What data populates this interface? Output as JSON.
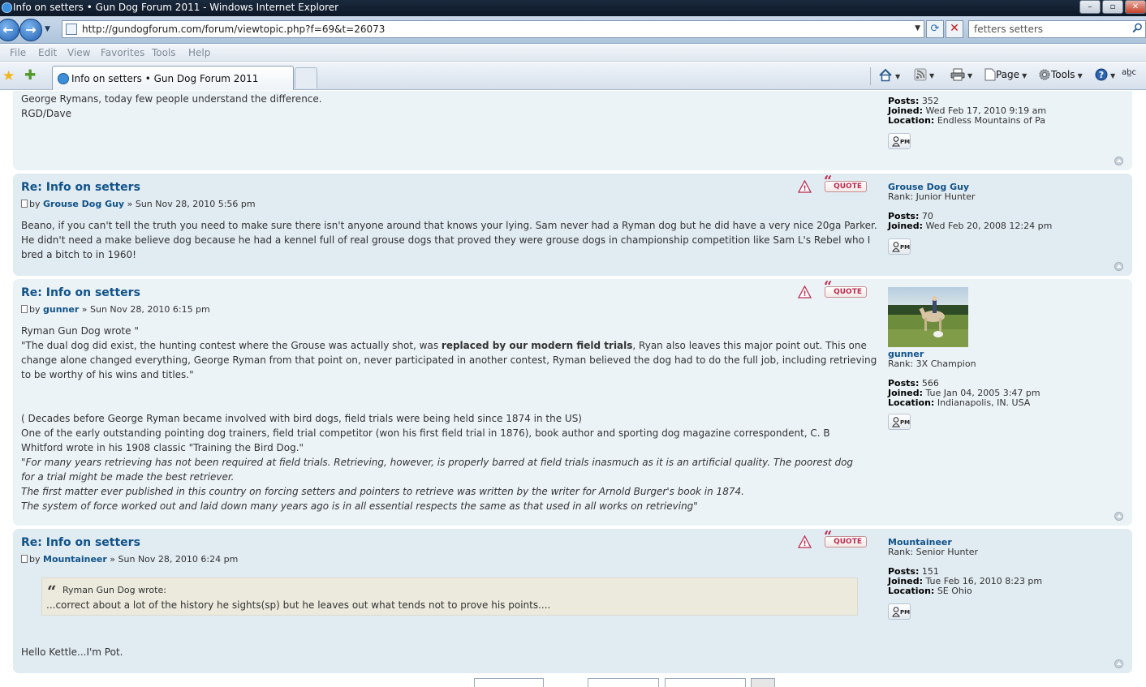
{
  "window": {
    "title": "Info on setters • Gun Dog Forum 2011 - Windows Internet Explorer",
    "min": "–",
    "max": "▫",
    "close": "✕"
  },
  "nav": {
    "back": "←",
    "forward": "→",
    "url": "http://gundogforum.com/forum/viewtopic.php?f=69&t=26073",
    "search_value": "fetters setters"
  },
  "menu": [
    "File",
    "Edit",
    "View",
    "Favorites",
    "Tools",
    "Help"
  ],
  "tab": {
    "label": "Info on setters • Gun Dog Forum 2011"
  },
  "commands": {
    "page": "Page",
    "tools": "Tools"
  },
  "colors": {
    "post_bg_1": "#ecf3f7",
    "post_bg_2": "#e1ebf2",
    "link": "#105289",
    "quote_red": "#bc2a4d"
  },
  "posts": [
    {
      "lines": [
        "George Rymans, today few people understand the difference.",
        "RGD/Dave"
      ],
      "profile": {
        "posts_label": "Posts:",
        "posts": "352",
        "joined_label": "Joined:",
        "joined": "Wed Feb 17, 2010 9:19 am",
        "location_label": "Location:",
        "location": "Endless Mountains of Pa"
      }
    },
    {
      "title": "Re: Info on setters",
      "by": "by",
      "author": "Grouse Dog Guy",
      "date": "» Sun Nov 28, 2010 5:56 pm",
      "lines": [
        "Beano, if you can't tell the truth you need to make sure there isn't anyone around that knows your lying. Sam never had a Ryman dog but he did have a very nice 20ga Parker.",
        "He didn't need a make believe dog because he had a kennel full of real grouse dogs that proved they were grouse dogs in championship competition like Sam L's Rebel who I",
        "bred a bitch to in 1960!"
      ],
      "profile": {
        "name": "Grouse Dog Guy",
        "rank": "Rank: Junior Hunter",
        "posts_label": "Posts:",
        "posts": "70",
        "joined_label": "Joined:",
        "joined": "Wed Feb 20, 2008 12:24 pm"
      },
      "quote": "QUOTE"
    },
    {
      "title": "Re: Info on setters",
      "by": "by",
      "author": "gunner",
      "date": "» Sun Nov 28, 2010 6:15 pm",
      "l1": "Ryman Gun Dog wrote \"",
      "l2a": "\"The dual dog did exist, the hunting contest where the Grouse was actually shot, was ",
      "l2b": "replaced by our modern field trials",
      "l2c": ", Ryan also leaves this major point out. This one",
      "l3": "change alone changed everything, George Ryman from that point on, never participated in another contest, Ryman believed the dog had to do the full job, including retrieving",
      "l4": "to be worthy of his wins and titles.\"",
      "l5": "( Decades before George Ryman became involved with bird dogs, field trials were being held since 1874 in the US)",
      "l6": "One of the early outstanding pointing dog trainers, field trial competitor (won his first field trial in 1876), book author and sporting dog magazine correspondent, C. B",
      "l7": "Whitford wrote in his 1908 classic \"Training the Bird Dog.\"",
      "l8": "\"For many years retrieving has not been required at field trials. Retrieving, however, is properly barred at field trials inasmuch as it is an artificial quality. The poorest dog",
      "l9": "for a trial might be made the best retriever.",
      "l10": "The first matter ever published in this country on forcing setters and pointers to retrieve was written by the writer for Arnold Burger's book in 1874.",
      "l11": "The system of force worked out and laid down many years ago is in all essential respects the same as that used in all works on retrieving\"",
      "profile": {
        "name": "gunner",
        "rank": "Rank: 3X Champion",
        "posts_label": "Posts:",
        "posts": "566",
        "joined_label": "Joined:",
        "joined": "Tue Jan 04, 2005 3:47 pm",
        "location_label": "Location:",
        "location": "Indianapolis, IN. USA"
      },
      "quote": "QUOTE"
    },
    {
      "title": "Re: Info on setters",
      "by": "by",
      "author": "Mountaineer",
      "date": "» Sun Nov 28, 2010 6:24 pm",
      "quote_cite": "Ryman Gun Dog wrote:",
      "quote_text": "...correct about a lot of the history he sights(sp) but he leaves out what tends not to prove his points....",
      "reply": "Hello Kettle...I'm Pot.",
      "profile": {
        "name": "Mountaineer",
        "rank": "Rank: Senior Hunter",
        "posts_label": "Posts:",
        "posts": "151",
        "joined_label": "Joined:",
        "joined": "Tue Feb 16, 2010 8:23 pm",
        "location_label": "Location:",
        "location": "SE Ohio"
      },
      "quote": "QUOTE"
    }
  ],
  "pm_label": "PM"
}
